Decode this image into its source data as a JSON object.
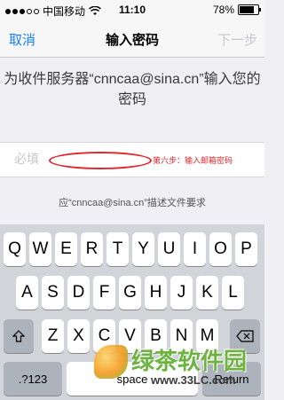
{
  "status_bar": {
    "carrier": "中国移动",
    "time": "11:10",
    "battery": "78%",
    "battery_level": 0.78
  },
  "nav": {
    "cancel": "取消",
    "title": "输入密码",
    "next": "下一步"
  },
  "prompt": "为收件服务器“cnncaa@sina.cn”输入您的密码",
  "password_field": {
    "placeholder": "必填",
    "value": ""
  },
  "annotation": "第六步：输入邮箱密码",
  "helper": "应“cnncaa@sina.cn”描述文件要求",
  "keyboard": {
    "row1": [
      "Q",
      "W",
      "E",
      "R",
      "T",
      "Y",
      "U",
      "I",
      "O",
      "P"
    ],
    "row2": [
      "A",
      "S",
      "D",
      "F",
      "G",
      "H",
      "J",
      "K",
      "L"
    ],
    "row3": [
      "Z",
      "X",
      "C",
      "V",
      "B",
      "N",
      "M"
    ],
    "numbers": ".?123",
    "space": "space",
    "return": "Return"
  },
  "watermark": {
    "text": "绿茶软件园",
    "url": "www.33LC.com"
  },
  "colors": {
    "accent": "#147efb",
    "disabled": "#c7c7cc",
    "annotation": "#e0262a"
  }
}
